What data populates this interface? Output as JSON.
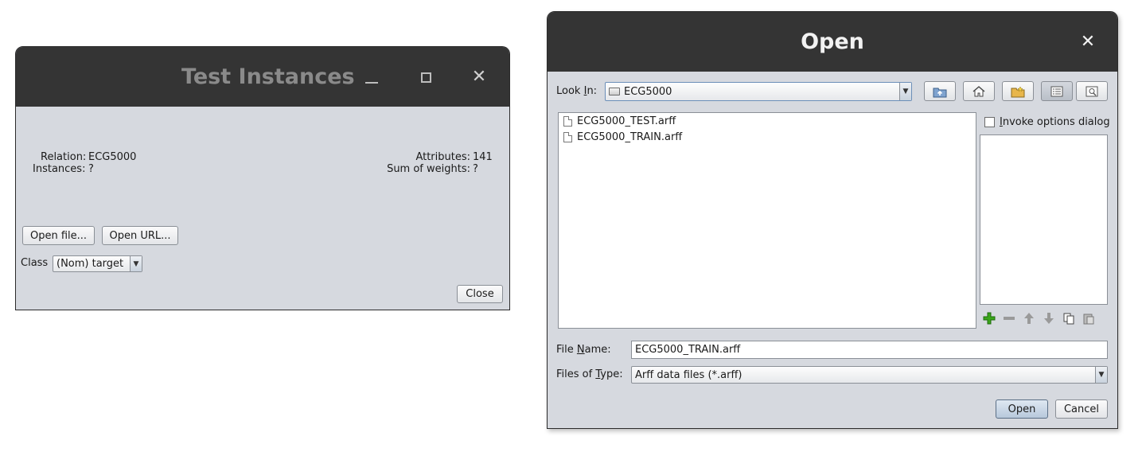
{
  "test_window": {
    "title": "Test Instances",
    "minimize_glyph": "—",
    "maximize_glyph": "☐",
    "close_glyph": "✕",
    "relation_label": "Relation:",
    "relation_value": "ECG5000",
    "instances_label": "Instances:",
    "instances_value": "?",
    "attributes_label": "Attributes:",
    "attributes_value": "141",
    "sum_weights_label": "Sum of weights:",
    "sum_weights_value": "?",
    "open_file_button": "Open file...",
    "open_url_button": "Open URL...",
    "class_label": "Class",
    "class_value": "(Nom) target",
    "close_button": "Close"
  },
  "open_dialog": {
    "title": "Open",
    "close_glyph": "✕",
    "look_in_pre": "Look ",
    "look_in_u": "I",
    "look_in_post": "n:",
    "look_in_value": "ECG5000",
    "toolbar_icons": [
      "up-folder-icon",
      "home-icon",
      "new-folder-icon",
      "list-view-icon",
      "details-view-icon"
    ],
    "files": [
      "ECG5000_TEST.arff",
      "ECG5000_TRAIN.arff"
    ],
    "invoke_pre": "",
    "invoke_u": "I",
    "invoke_post": "nvoke options dialog",
    "invoke_checked": false,
    "file_name_pre": "File ",
    "file_name_u": "N",
    "file_name_post": "ame:",
    "file_name_value": "ECG5000_TRAIN.arff",
    "files_of_type_pre": "Files of ",
    "files_of_type_u": "T",
    "files_of_type_post": "ype:",
    "files_of_type_value": "Arff data files (*.arff)",
    "open_button": "Open",
    "cancel_button": "Cancel"
  },
  "colors": {
    "titlebar": "#343434",
    "window_bg": "#d6d9df",
    "accent_green": "#3aa61a"
  }
}
